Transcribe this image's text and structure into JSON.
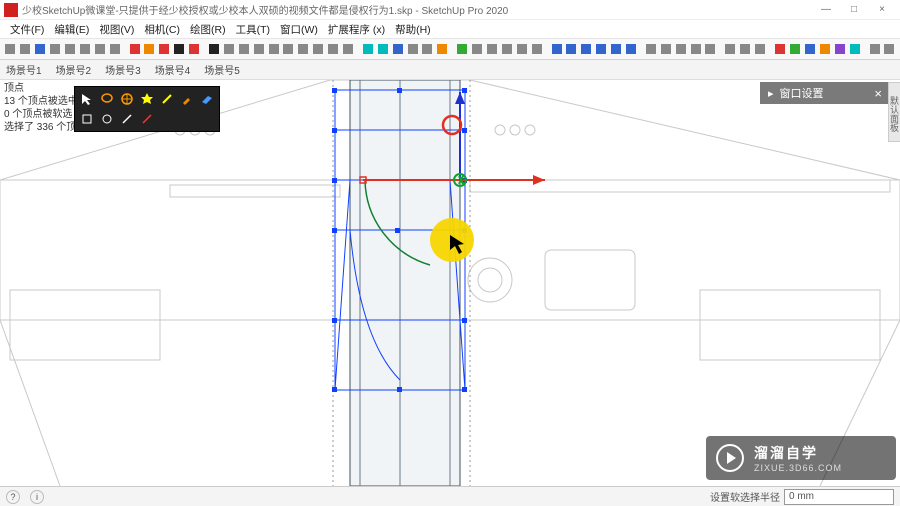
{
  "window": {
    "app_icon": "sketchup-icon",
    "title": "少校SketchUp微课堂-只提供于经少校授权或少校本人双硕的视频文件都是侵权行为1.skp - SketchUp Pro 2020",
    "min": "—",
    "max": "□",
    "close": "×"
  },
  "menu": {
    "items": [
      "文件(F)",
      "编辑(E)",
      "视图(V)",
      "相机(C)",
      "绘图(R)",
      "工具(T)",
      "窗口(W)",
      "扩展程序 (x)",
      "帮助(H)"
    ]
  },
  "toolbar1": {
    "icons": [
      "new",
      "open",
      "save",
      "cut",
      "copy",
      "paste",
      "undo",
      "redo",
      "sep",
      "boxred",
      "boxblue",
      "boxgreen",
      "sep",
      "camera",
      "camera2",
      "sep",
      "cursor",
      "rect",
      "line",
      "arc",
      "circle",
      "poly",
      "offset",
      "move",
      "rotate",
      "scale",
      "tape",
      "protractor",
      "sep",
      "axis",
      "dims",
      "text",
      "3dtext",
      "section",
      "walk",
      "look",
      "zoom",
      "pan",
      "orbit",
      "zoomext",
      "prev",
      "next",
      "sep",
      "iso",
      "top",
      "front",
      "right",
      "back",
      "left",
      "sep",
      "shade1",
      "shade2",
      "shade3",
      "shade4",
      "shade5",
      "sep",
      "xray",
      "fog",
      "shadows",
      "edges",
      "sep",
      "red",
      "green",
      "blue",
      "orange",
      "purple",
      "cyan",
      "sep",
      "help",
      "info"
    ]
  },
  "secondbar": {
    "items": [
      "场景号1",
      "场景号2",
      "场景号3",
      "场景号4",
      "场景号5"
    ]
  },
  "left_info": {
    "line1": "顶点",
    "line2": "13 个顶点被选中",
    "line3": "0 个顶点被软选",
    "line4": "选择了 336 个顶点"
  },
  "vertex_toolbar": {
    "row1": [
      "pointer",
      "lasso",
      "gizmo",
      "star",
      "wand",
      "brush",
      "plane"
    ],
    "row2": [
      "box",
      "circle",
      "slash",
      "slash-red",
      "blank",
      "blank",
      "blank"
    ]
  },
  "right_panel": {
    "arrow": "▸",
    "title": "窗口设置",
    "close": "×"
  },
  "right_tab": {
    "label": "默认面板"
  },
  "watermark": {
    "brand": "溜溜自学",
    "url": "ZIXUE.3D66.COM"
  },
  "statusbar": {
    "icon1": "?",
    "icon2": "i",
    "measure_label": "设置软选择半径",
    "measure_value": "0 mm"
  },
  "colors": {
    "accent_yellow": "#f7d500",
    "axis_red": "#e03020",
    "axis_green": "#108030",
    "axis_blue": "#2030d0",
    "handle_blue": "#1040ff",
    "guide_gray": "#9a9a9a"
  }
}
